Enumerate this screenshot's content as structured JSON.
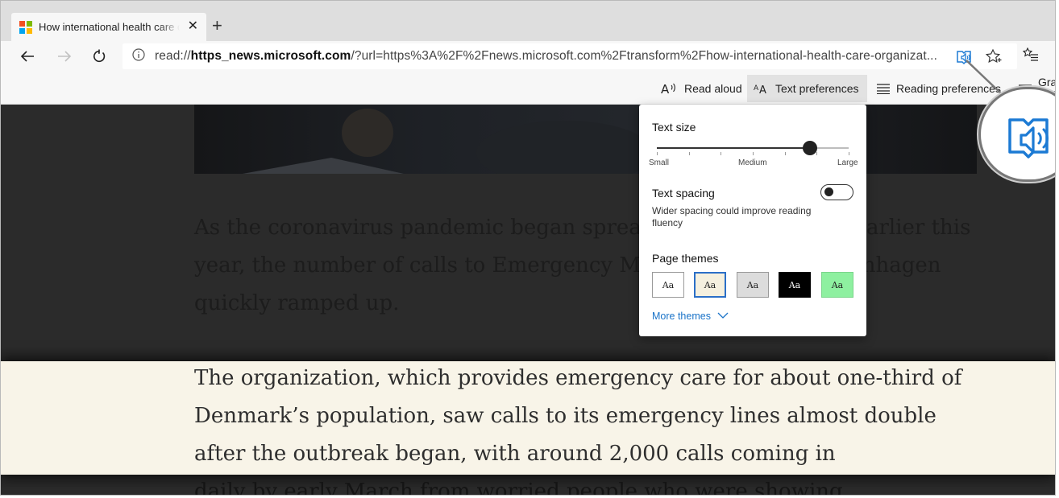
{
  "tab": {
    "title": "How international health care organizations",
    "close_glyph": "✕",
    "new_tab_glyph": "+",
    "favicon_colors": [
      "#f25022",
      "#7fba00",
      "#00a4ef",
      "#ffb900"
    ]
  },
  "navbar": {
    "back_icon": "back-arrow-icon",
    "forward_icon": "forward-arrow-icon",
    "refresh_icon": "refresh-icon",
    "url_prefix": "read://",
    "url_host": "https_news.microsoft.com",
    "url_rest": "/?url=https%3A%2F%2Fnews.microsoft.com%2Ftransform%2Fhow-international-health-care-organizat...",
    "reader_icon": "immersive-reader-icon",
    "favorite_icon": "star-plus-icon",
    "favorites_bar_icon": "favorites-list-icon"
  },
  "reader_toolbar": {
    "read_aloud": "Read aloud",
    "text_preferences": "Text preferences",
    "reading_preferences": "Reading preferences",
    "grammar_tools": "Grammar tools"
  },
  "article": {
    "para1": "As the coronavirus pandemic began spreading across Europe earlier this year, the number of calls to Emergency Medical Services Copenhagen quickly ramped up.",
    "para2": "The organization, which provides emergency care for about one-third of Denmark’s population, saw calls to its emergency lines almost double after the outbreak began, with around 2,000 calls coming in",
    "para3": "daily by early March from worried people who were showing"
  },
  "text_prefs": {
    "text_size_heading": "Text size",
    "slider_level": 0.8,
    "slider_ticks": 7,
    "slider_labels": {
      "small": "Small",
      "medium": "Medium",
      "large": "Large"
    },
    "text_spacing_heading": "Text spacing",
    "text_spacing_desc": "Wider spacing could improve reading fluency",
    "text_spacing_on": false,
    "page_themes_heading": "Page themes",
    "theme_sample": "Aa",
    "selected_theme": "sepia",
    "more_themes": "More themes",
    "accent_color": "#1a73c8"
  },
  "colors": {
    "reader_icon_blue": "#1c7ad4",
    "highlight_bg": "#f8f4e8",
    "dimmed_bg": "#2b2b2b"
  }
}
